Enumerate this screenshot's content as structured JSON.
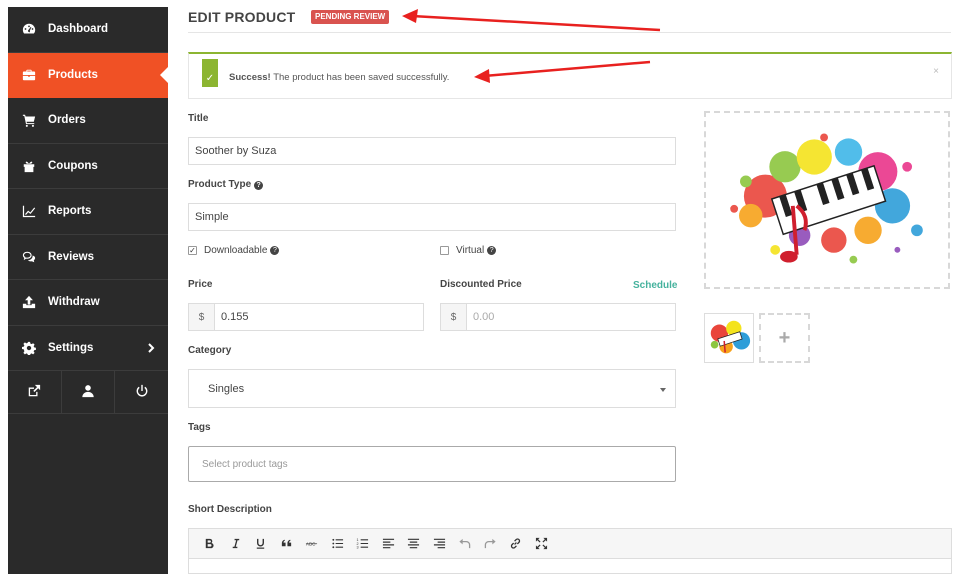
{
  "sidebar": {
    "items": [
      {
        "label": "Dashboard",
        "icon": "dashboard-icon"
      },
      {
        "label": "Products",
        "icon": "briefcase-icon",
        "active": true
      },
      {
        "label": "Orders",
        "icon": "cart-icon"
      },
      {
        "label": "Coupons",
        "icon": "gift-icon"
      },
      {
        "label": "Reports",
        "icon": "chart-icon"
      },
      {
        "label": "Reviews",
        "icon": "comments-icon"
      },
      {
        "label": "Withdraw",
        "icon": "upload-icon"
      },
      {
        "label": "Settings",
        "icon": "gear-icon"
      }
    ],
    "tools": [
      "external-link-icon",
      "user-icon",
      "power-icon"
    ],
    "accent": "#f05125"
  },
  "header": {
    "title": "EDIT PRODUCT",
    "status_badge": "PENDING REVIEW"
  },
  "alert": {
    "strong": "Success!",
    "message": " The product has been saved successfully.",
    "close": "×",
    "color": "#8cb531"
  },
  "form": {
    "title_label": "Title",
    "title_value": "Soother by Suza",
    "product_type_label": "Product Type",
    "product_type_value": "Simple",
    "downloadable_label": "Downloadable",
    "downloadable_checked": true,
    "virtual_label": "Virtual",
    "virtual_checked": false,
    "price_label": "Price",
    "currency": "$",
    "price_value": "0.155",
    "discounted_label": "Discounted Price",
    "discounted_placeholder": "0.00",
    "schedule_link": "Schedule",
    "category_label": "Category",
    "category_value": "Singles",
    "tags_label": "Tags",
    "tags_placeholder": "Select product tags",
    "short_description_label": "Short Description"
  },
  "editor": {
    "toolbar": [
      "bold-icon",
      "italic-icon",
      "underline-icon",
      "blockquote-icon",
      "strikethrough-icon",
      "bullet-list-icon",
      "numbered-list-icon",
      "align-left-icon",
      "align-center-icon",
      "align-right-icon",
      "undo-icon",
      "redo-icon",
      "link-icon",
      "fullscreen-icon"
    ]
  },
  "images": {
    "add_symbol": "+"
  }
}
